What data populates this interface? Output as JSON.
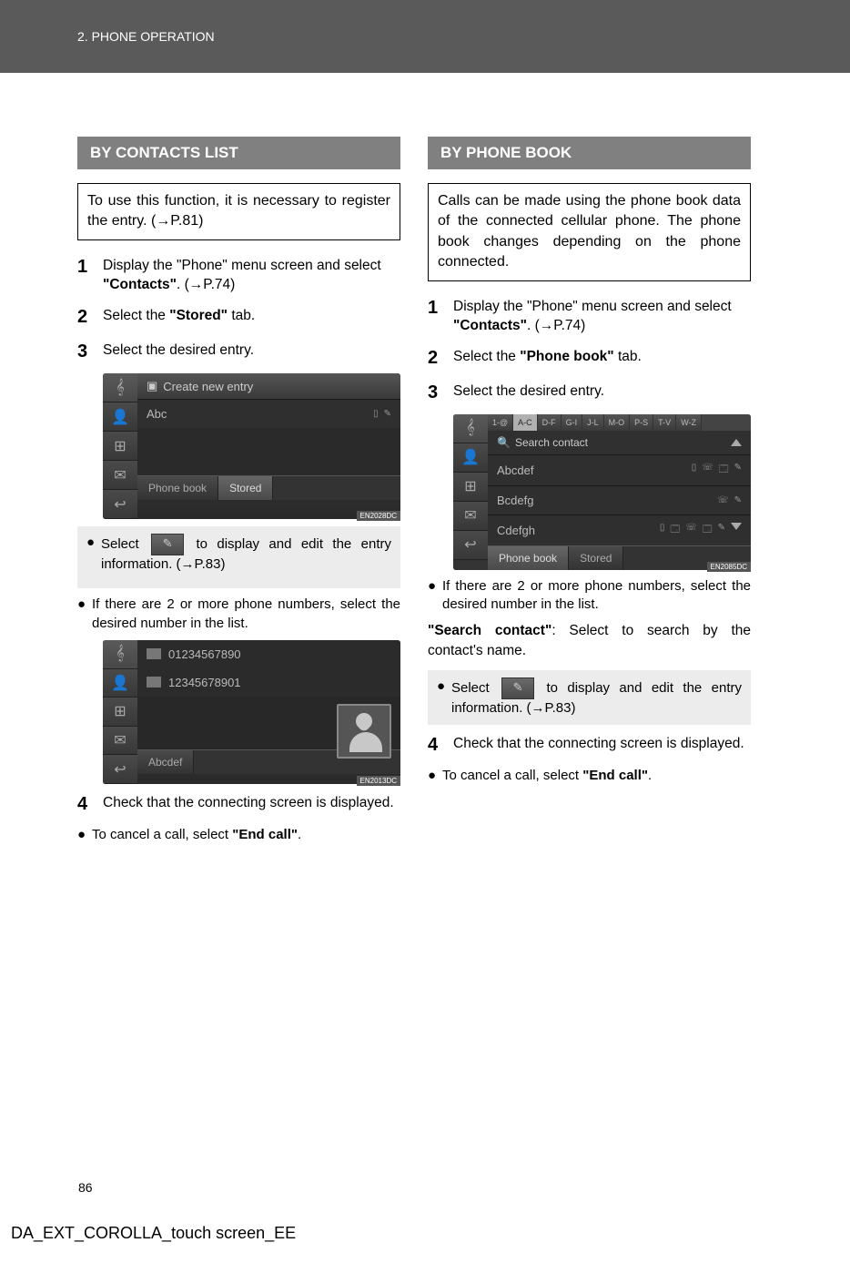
{
  "header": {
    "breadcrumb": "2. PHONE OPERATION"
  },
  "left": {
    "title": "BY CONTACTS LIST",
    "info": "To use this function, it is necessary to register the entry. (→P.81)",
    "step1": "Display the \"Phone\" menu screen and select ",
    "step1b": "\"Contacts\"",
    "step1c": ". (→P.74)",
    "step2a": "Select the ",
    "step2b": "\"Stored\"",
    "step2c": " tab.",
    "step3": "Select the desired entry.",
    "scr1": {
      "create": "Create new entry",
      "entry": "Abc",
      "tab1": "Phone book",
      "tab2": "Stored",
      "code": "EN2028DC"
    },
    "bullet1a": "Select ",
    "bullet1b": " to display and edit the entry information. (→P.83)",
    "bullet2": "If there are 2 or more phone numbers, select the desired number in the list.",
    "scr2": {
      "num1": "01234567890",
      "num2": "12345678901",
      "name": "Abcdef",
      "code": "EN2013DC"
    },
    "step4": "Check that the connecting screen is displayed.",
    "bullet3a": "To cancel a call, select ",
    "bullet3b": "\"End call\"",
    "bullet3c": "."
  },
  "right": {
    "title": "BY PHONE BOOK",
    "info": "Calls can be made using the phone book data of the connected cellular phone. The phone book changes depending on the phone connected.",
    "step1": "Display the \"Phone\" menu screen and select ",
    "step1b": "\"Contacts\"",
    "step1c": ". (→P.74)",
    "step2a": "Select the ",
    "step2b": "\"Phone book\"",
    "step2c": " tab.",
    "step3": "Select the desired entry.",
    "scr": {
      "alpha": [
        "1-@",
        "A-C",
        "D-F",
        "G-I",
        "J-L",
        "M-O",
        "P-S",
        "T-V",
        "W-Z"
      ],
      "search": "Search contact",
      "e1": "Abcdef",
      "e2": "Bcdefg",
      "e3": "Cdefgh",
      "tab1": "Phone book",
      "tab2": "Stored",
      "code": "EN2085DC"
    },
    "bullet1": "If there are 2 or more phone numbers, select the desired number in the list.",
    "searchnote_a": "\"Search contact\"",
    "searchnote_b": ": Select to search by the contact's name.",
    "bullet2a": "Select ",
    "bullet2b": " to display and edit the entry information. (→P.83)",
    "step4": "Check that the connecting screen is displayed.",
    "bullet3a": "To cancel a call, select ",
    "bullet3b": "\"End call\"",
    "bullet3c": "."
  },
  "pagenum": "86",
  "footer": "DA_EXT_COROLLA_touch screen_EE",
  "icons": {
    "edit": "✎"
  }
}
